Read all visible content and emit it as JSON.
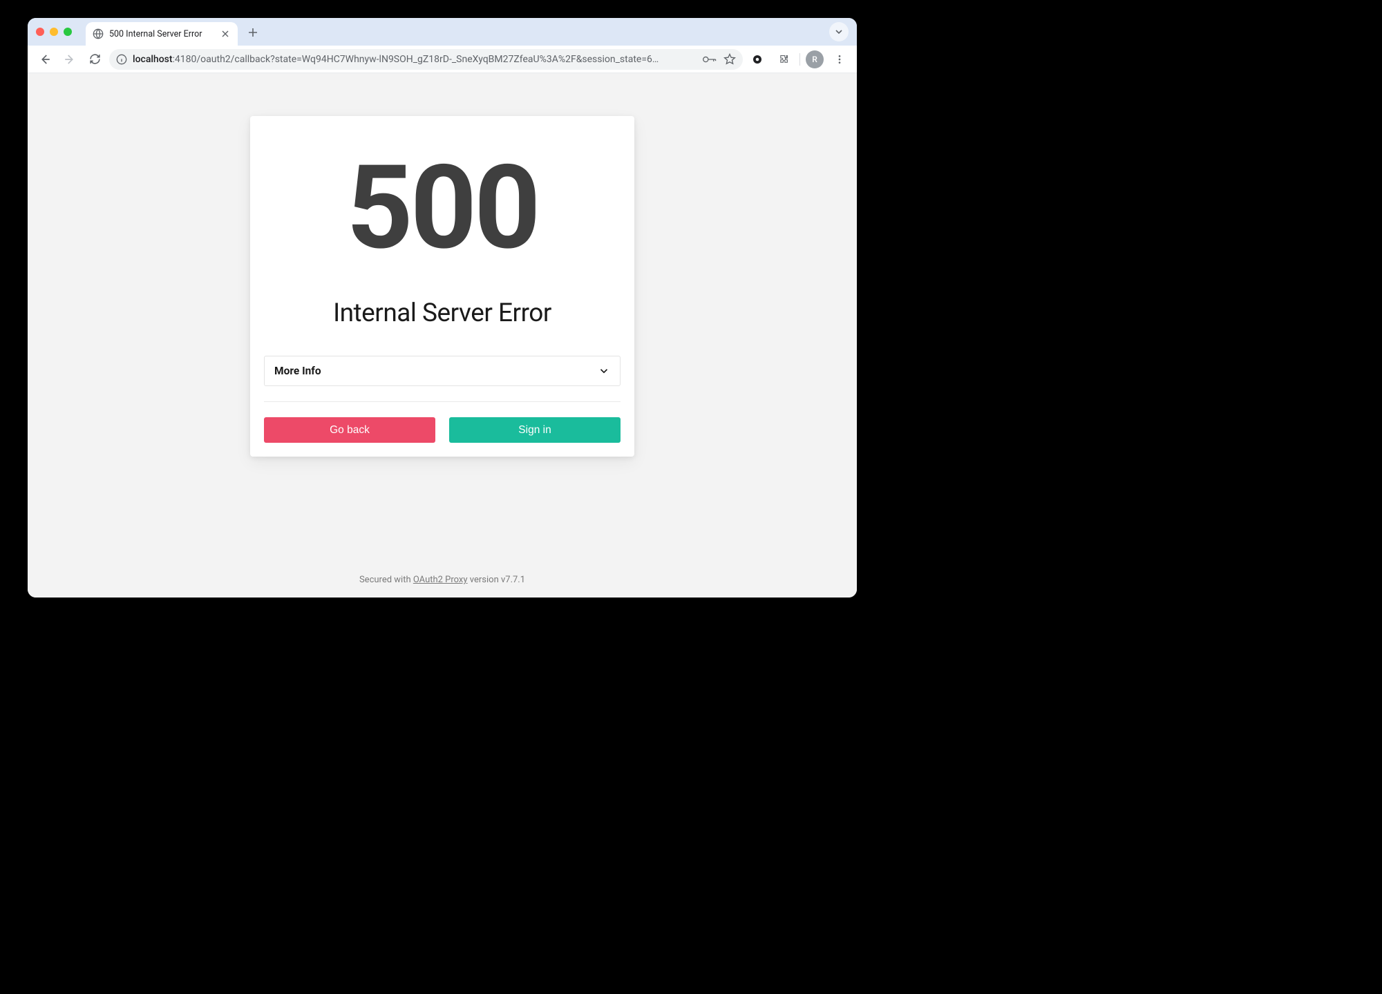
{
  "browser": {
    "tab_title": "500 Internal Server Error",
    "url_host": "localhost",
    "url_path": ":4180/oauth2/callback?state=Wq94HC7Whnyw-lN9SOH_gZ18rD-_SneXyqBM27ZfeaU%3A%2F&session_state=6…",
    "avatar_letter": "R"
  },
  "error": {
    "code": "500",
    "title": "Internal Server Error",
    "more_info_label": "More Info",
    "go_back_label": "Go back",
    "sign_in_label": "Sign in"
  },
  "footer": {
    "prefix": "Secured with ",
    "link": "OAuth2 Proxy",
    "suffix": " version v7.7.1"
  }
}
